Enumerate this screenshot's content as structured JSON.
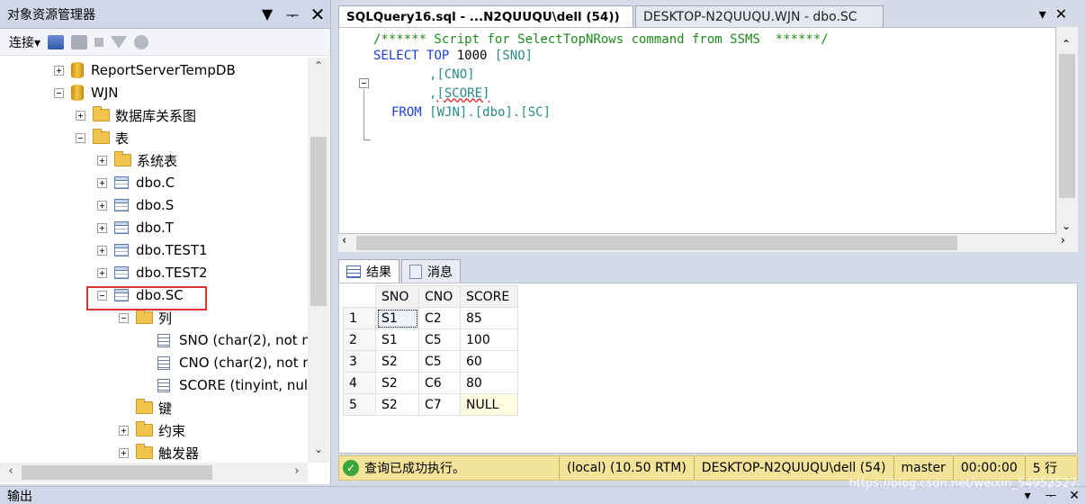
{
  "object_explorer": {
    "title": "对象资源管理器",
    "toolbar_connect": "连接",
    "tree": [
      {
        "label": "ReportServerTempDB",
        "icon": "database-icon",
        "expander": "plus"
      },
      {
        "label": "WJN",
        "icon": "database-icon",
        "expander": "minus"
      },
      {
        "label": "数据库关系图",
        "icon": "folder-icon",
        "expander": "plus"
      },
      {
        "label": "表",
        "icon": "folder-icon",
        "expander": "minus"
      },
      {
        "label": "系统表",
        "icon": "folder-icon",
        "expander": "plus"
      },
      {
        "label": "dbo.C",
        "icon": "table-icon",
        "expander": "plus"
      },
      {
        "label": "dbo.S",
        "icon": "table-icon",
        "expander": "plus"
      },
      {
        "label": "dbo.T",
        "icon": "table-icon",
        "expander": "plus"
      },
      {
        "label": "dbo.TEST1",
        "icon": "table-icon",
        "expander": "plus"
      },
      {
        "label": "dbo.TEST2",
        "icon": "table-icon",
        "expander": "plus"
      },
      {
        "label": "dbo.SC",
        "icon": "table-icon",
        "expander": "minus",
        "highlighted": true
      },
      {
        "label": "列",
        "icon": "folder-icon",
        "expander": "minus"
      },
      {
        "label": "SNO (char(2), not n",
        "icon": "column-icon",
        "expander": "none"
      },
      {
        "label": "CNO (char(2), not n",
        "icon": "column-icon",
        "expander": "none"
      },
      {
        "label": "SCORE (tinyint, null)",
        "icon": "column-icon",
        "expander": "none"
      },
      {
        "label": "键",
        "icon": "folder-icon",
        "expander": "none"
      },
      {
        "label": "约束",
        "icon": "folder-icon",
        "expander": "plus"
      },
      {
        "label": "触发器",
        "icon": "folder-icon",
        "expander": "plus"
      }
    ]
  },
  "editor": {
    "tabs": [
      {
        "label": "SQLQuery16.sql - ...N2QUUQU\\dell (54))",
        "active": true
      },
      {
        "label": "DESKTOP-N2QUUQU.WJN - dbo.SC",
        "active": false
      }
    ],
    "code": {
      "line1": "/****** Script for SelectTopNRows command from SSMS  ******/",
      "select_kw": "SELECT",
      "top_kw": "TOP",
      "top_n": "1000",
      "col1": "[SNO]",
      "comma": ",",
      "col2": "[CNO]",
      "col3": "[SCORE]",
      "from_kw": "FROM",
      "table_ref": "[WJN].[dbo].[SC]"
    }
  },
  "results": {
    "tab_results": "结果",
    "tab_messages": "消息",
    "columns": [
      "SNO",
      "CNO",
      "SCORE"
    ],
    "rows": [
      {
        "n": "1",
        "SNO": "S1",
        "CNO": "C2",
        "SCORE": "85"
      },
      {
        "n": "2",
        "SNO": "S1",
        "CNO": "C5",
        "SCORE": "100"
      },
      {
        "n": "3",
        "SNO": "S2",
        "CNO": "C5",
        "SCORE": "60"
      },
      {
        "n": "4",
        "SNO": "S2",
        "CNO": "C6",
        "SCORE": "80"
      },
      {
        "n": "5",
        "SNO": "S2",
        "CNO": "C7",
        "SCORE": "NULL"
      }
    ]
  },
  "status": {
    "message": "查询已成功执行。",
    "server": "(local) (10.50 RTM)",
    "connection": "DESKTOP-N2QUUQU\\dell (54)",
    "database": "master",
    "elapsed": "00:00:00",
    "rows": "5 行"
  },
  "output": {
    "title": "输出"
  },
  "watermark": "https://blog.csdn.net/weixin_54952527"
}
